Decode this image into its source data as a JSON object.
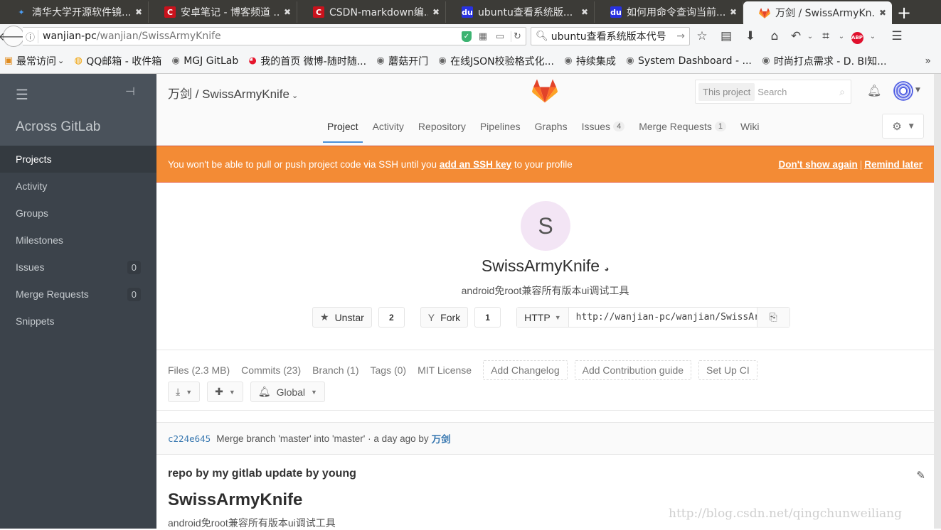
{
  "browser": {
    "tabs": [
      {
        "title": "清华大学开源软件镜...",
        "icon": "tuna-icon",
        "glyph": "✦"
      },
      {
        "title": "安卓笔记 - 博客频道 ...",
        "icon": "csdn-icon",
        "glyph": "C"
      },
      {
        "title": "CSDN-markdown编...",
        "icon": "csdn-icon",
        "glyph": "C"
      },
      {
        "title": "ubuntu查看系统版...",
        "icon": "baidu-icon",
        "glyph": "du"
      },
      {
        "title": "如何用命令查询当前...",
        "icon": "baidu-icon",
        "glyph": "du"
      },
      {
        "title": "万剑 / SwissArmyKn...",
        "icon": "gitlab-icon",
        "glyph": "",
        "active": true
      }
    ],
    "close_glyph": "✖",
    "new_tab_glyph": "+",
    "url_host": "wanjian-pc",
    "url_path": "/wanjian/SwissArmyKnife",
    "search_value": "ubuntu查看系统版本代号",
    "bookmarks": [
      {
        "label": "最常访问",
        "icon": "folder-icon",
        "glyph": "▣",
        "dropdown": "⌄"
      },
      {
        "label": "QQ邮箱 - 收件箱",
        "icon": "qqmail-icon",
        "glyph": "◍"
      },
      {
        "label": "MGJ GitLab",
        "icon": "globe-icon",
        "glyph": "◉"
      },
      {
        "label": "我的首页 微博-随时随...",
        "icon": "weibo-icon",
        "glyph": "◕"
      },
      {
        "label": "蘑菇开门",
        "icon": "globe-icon",
        "glyph": "◉"
      },
      {
        "label": "在线JSON校验格式化...",
        "icon": "globe-icon",
        "glyph": "◉"
      },
      {
        "label": "持续集成",
        "icon": "globe-icon",
        "glyph": "◉"
      },
      {
        "label": "System Dashboard - ...",
        "icon": "globe-icon",
        "glyph": "◉"
      },
      {
        "label": "时尚打点需求 - D. BI知...",
        "icon": "globe-icon",
        "glyph": "◉"
      }
    ],
    "bookmarks_more": "»"
  },
  "sidebar": {
    "title": "Across GitLab",
    "items": [
      {
        "label": "Projects",
        "active": true
      },
      {
        "label": "Activity"
      },
      {
        "label": "Groups"
      },
      {
        "label": "Milestones"
      },
      {
        "label": "Issues",
        "count": "0"
      },
      {
        "label": "Merge Requests",
        "count": "0"
      },
      {
        "label": "Snippets"
      }
    ]
  },
  "header": {
    "namespace": "万剑",
    "project": "SwissArmyKnife",
    "search_scope": "This project",
    "search_placeholder": "Search",
    "nav": [
      {
        "label": "Project",
        "active": true
      },
      {
        "label": "Activity"
      },
      {
        "label": "Repository"
      },
      {
        "label": "Pipelines"
      },
      {
        "label": "Graphs"
      },
      {
        "label": "Issues",
        "badge": "4"
      },
      {
        "label": "Merge Requests",
        "badge": "1"
      },
      {
        "label": "Wiki"
      }
    ]
  },
  "alert": {
    "prefix": "You won't be able to pull or push project code via SSH until you",
    "link": "add an SSH key",
    "suffix": "to your profile",
    "dont_show": "Don't show again",
    "separator": "|",
    "remind": "Remind later",
    "color": "#f38b35"
  },
  "project": {
    "avatar_letter": "S",
    "name": "SwissArmyKnife",
    "description": "android免root兼容所有版本ui调试工具",
    "unstar_label": "Unstar",
    "star_count": "2",
    "fork_label": "Fork",
    "fork_count": "1",
    "clone_protocol": "HTTP",
    "clone_url": "http://wanjian-pc/wanjian/SwissArmyKnife.git"
  },
  "stats": {
    "links": [
      "Files (2.3 MB)",
      "Commits (23)",
      "Branch (1)",
      "Tags (0)",
      "MIT License"
    ],
    "dashed": [
      "Add Changelog",
      "Add Contribution guide",
      "Set Up CI"
    ],
    "notification_level": "Global"
  },
  "last_commit": {
    "sha": "c224e645",
    "message": "Merge branch 'master' into 'master' · a day ago by",
    "author": "万剑"
  },
  "readme": {
    "file_title": "repo by my gitlab update by young",
    "h1": "SwissArmyKnife",
    "paragraph": "android免root兼容所有版本ui调试工具"
  },
  "watermark": "http://blog.csdn.net/qingchunweiliang"
}
